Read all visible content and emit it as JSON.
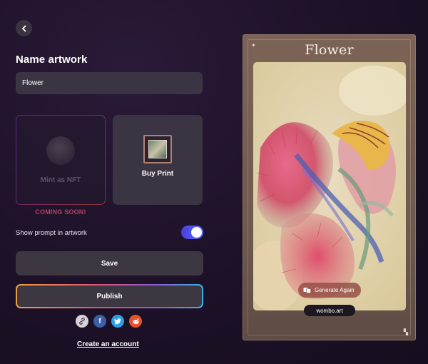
{
  "header": {
    "title": "Name artwork"
  },
  "form": {
    "artwork_name": "Flower"
  },
  "options": {
    "nft_label": "Mint as NFT",
    "print_label": "Buy Print",
    "coming_soon": "COMING SOON!"
  },
  "prompt_toggle": {
    "label": "Show prompt in artwork",
    "enabled": true
  },
  "actions": {
    "save_label": "Save",
    "publish_label": "Publish",
    "create_account_label": "Create an account"
  },
  "share": {
    "icons": [
      "link-icon",
      "facebook-icon",
      "twitter-icon",
      "reddit-icon"
    ]
  },
  "artwork": {
    "title": "Flower",
    "generate_again_label": "Generate Again",
    "watermark": "wombo.art"
  },
  "colors": {
    "accent_toggle": "#4a3ee0",
    "coming_soon": "#b8405d"
  }
}
